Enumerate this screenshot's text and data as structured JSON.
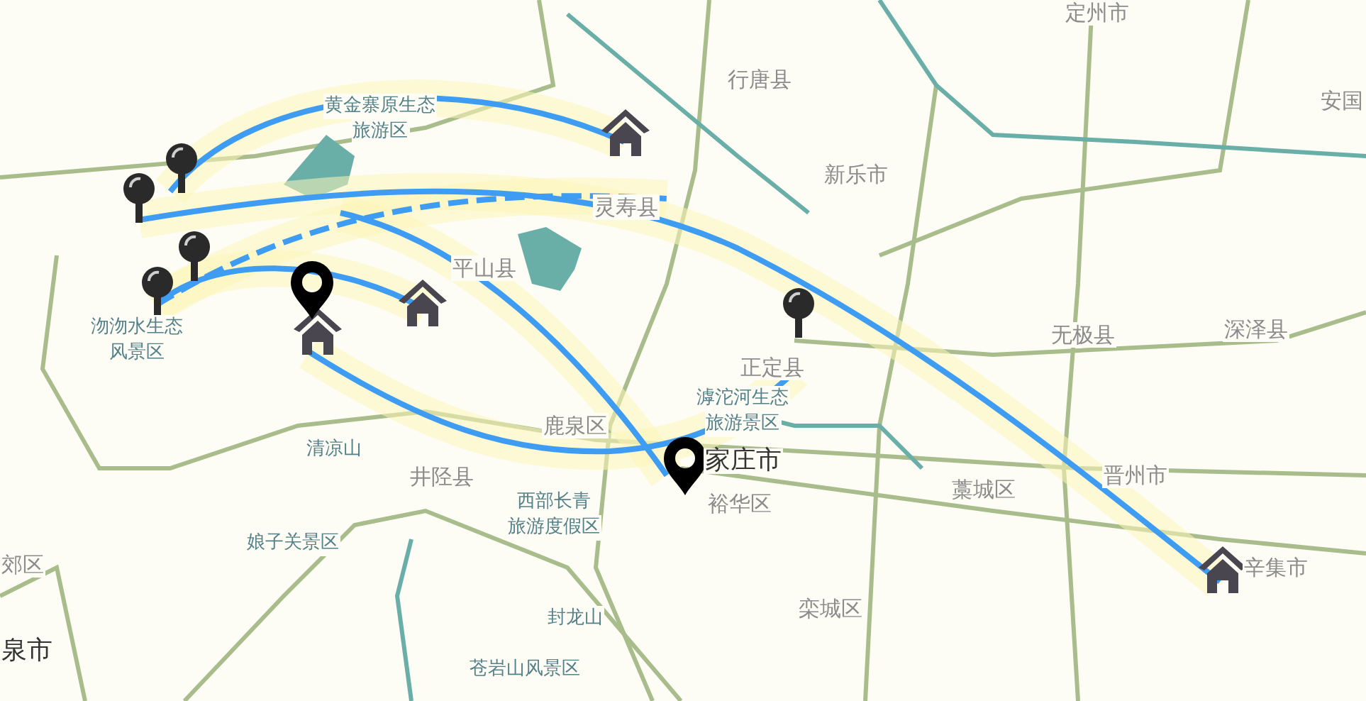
{
  "map": {
    "labels": [
      {
        "kind": "scenic",
        "lines": [
          "黄金寨原生态",
          "旅游区"
        ]
      },
      {
        "kind": "district",
        "lines": [
          "行唐县"
        ]
      },
      {
        "kind": "district",
        "lines": [
          "定州市"
        ]
      },
      {
        "kind": "district",
        "lines": [
          "安国"
        ]
      },
      {
        "kind": "district",
        "lines": [
          "新乐市"
        ]
      },
      {
        "kind": "district",
        "lines": [
          "灵寿县"
        ]
      },
      {
        "kind": "district",
        "lines": [
          "平山县"
        ]
      },
      {
        "kind": "scenic",
        "lines": [
          "沕沕水生态",
          "风景区"
        ]
      },
      {
        "kind": "district",
        "lines": [
          "正定县"
        ]
      },
      {
        "kind": "scenic",
        "lines": [
          "滹沱河生态",
          "旅游景区"
        ]
      },
      {
        "kind": "district",
        "lines": [
          "无极县"
        ]
      },
      {
        "kind": "district",
        "lines": [
          "深泽县"
        ]
      },
      {
        "kind": "district",
        "lines": [
          "鹿泉区"
        ]
      },
      {
        "kind": "scenic",
        "lines": [
          "清凉山"
        ]
      },
      {
        "kind": "district",
        "lines": [
          "井陉县"
        ]
      },
      {
        "kind": "scenic",
        "lines": [
          "西部长青",
          "旅游度假区"
        ]
      },
      {
        "kind": "scenic",
        "lines": [
          "娘子关景区"
        ]
      },
      {
        "kind": "district",
        "lines": [
          "郊区"
        ]
      },
      {
        "kind": "city",
        "lines": [
          "泉市"
        ]
      },
      {
        "kind": "city",
        "lines": [
          "家庄市"
        ]
      },
      {
        "kind": "district",
        "lines": [
          "裕华区"
        ]
      },
      {
        "kind": "district",
        "lines": [
          "藁城区"
        ]
      },
      {
        "kind": "district",
        "lines": [
          "晋州市"
        ]
      },
      {
        "kind": "district",
        "lines": [
          "辛集市"
        ]
      },
      {
        "kind": "district",
        "lines": [
          "栾城区"
        ]
      },
      {
        "kind": "scenic",
        "lines": [
          "封龙山"
        ]
      },
      {
        "kind": "scenic",
        "lines": [
          "苍岩山风景区"
        ]
      }
    ]
  }
}
